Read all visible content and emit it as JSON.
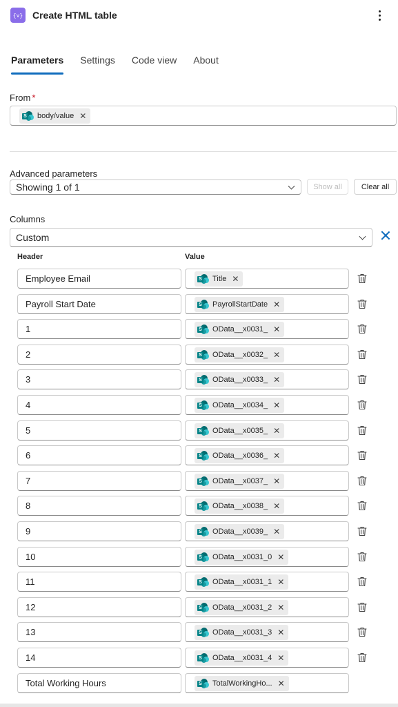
{
  "header": {
    "icon_text": "{v}",
    "title": "Create HTML table",
    "more_icon": "more-vertical-icon"
  },
  "tabs": [
    {
      "label": "Parameters",
      "active": true
    },
    {
      "label": "Settings",
      "active": false
    },
    {
      "label": "Code view",
      "active": false
    },
    {
      "label": "About",
      "active": false
    }
  ],
  "from": {
    "label": "From",
    "required_mark": "*",
    "token": {
      "icon": "sharepoint-icon",
      "text": "body/value"
    }
  },
  "advanced": {
    "label": "Advanced parameters",
    "select_value": "Showing 1 of 1",
    "show_all": "Show all",
    "clear_all": "Clear all"
  },
  "columns": {
    "label": "Columns",
    "select_value": "Custom",
    "header_label": "Header",
    "value_label": "Value",
    "rows": [
      {
        "header": "Employee Email",
        "value": "Title"
      },
      {
        "header": "Payroll Start Date",
        "value": "PayrollStartDate"
      },
      {
        "header": "1",
        "value": "OData__x0031_"
      },
      {
        "header": "2",
        "value": "OData__x0032_"
      },
      {
        "header": "3",
        "value": "OData__x0033_"
      },
      {
        "header": "4",
        "value": "OData__x0034_"
      },
      {
        "header": "5",
        "value": "OData__x0035_"
      },
      {
        "header": "6",
        "value": "OData__x0036_"
      },
      {
        "header": "7",
        "value": "OData__x0037_"
      },
      {
        "header": "8",
        "value": "OData__x0038_"
      },
      {
        "header": "9",
        "value": "OData__x0039_"
      },
      {
        "header": "10",
        "value": "OData__x0031_0"
      },
      {
        "header": "11",
        "value": "OData__x0031_1"
      },
      {
        "header": "12",
        "value": "OData__x0031_2"
      },
      {
        "header": "13",
        "value": "OData__x0031_3"
      },
      {
        "header": "14",
        "value": "OData__x0031_4"
      },
      {
        "header": "Total Working Hours",
        "value": "TotalWorkingHo..."
      }
    ]
  },
  "colors": {
    "accent": "#0f6cbd",
    "app_icon": "#8a6de9",
    "token_bg": "#ebebeb",
    "required": "#c50f1f"
  }
}
